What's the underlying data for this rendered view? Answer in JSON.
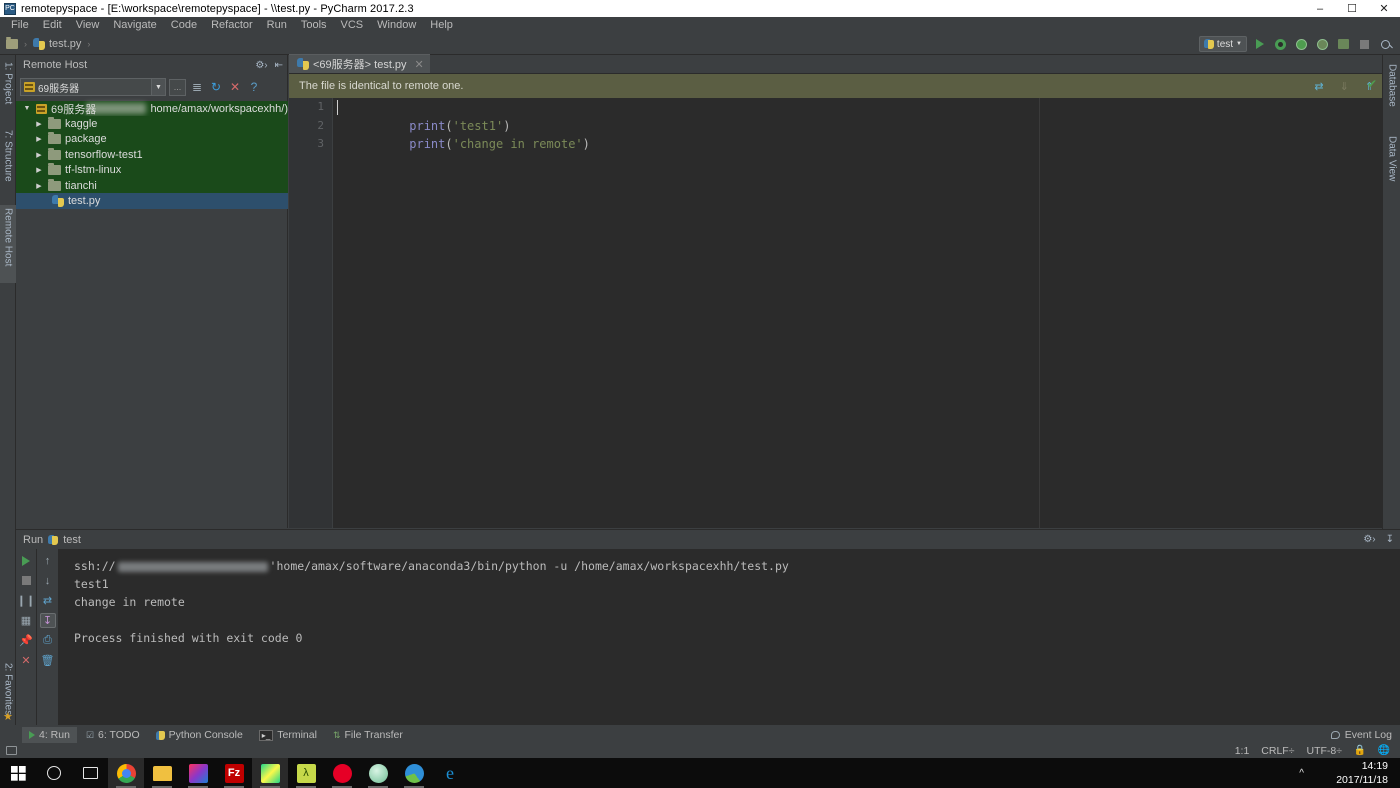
{
  "window": {
    "title": "remotepyspace - [E:\\workspace\\remotepyspace] - \\\\test.py - PyCharm 2017.2.3",
    "app_icon": "pycharm-icon",
    "minimize": "–",
    "maximize": "☐",
    "close": "✕"
  },
  "menu": {
    "items": [
      {
        "label": "File"
      },
      {
        "label": "Edit"
      },
      {
        "label": "View"
      },
      {
        "label": "Navigate"
      },
      {
        "label": "Code"
      },
      {
        "label": "Refactor"
      },
      {
        "label": "Run"
      },
      {
        "label": "Tools"
      },
      {
        "label": "VCS"
      },
      {
        "label": "Window"
      },
      {
        "label": "Help"
      }
    ]
  },
  "toolbar": {
    "breadcrumb_file": "test.py",
    "run_config": "test",
    "run_config_arrow": "▼",
    "icons": [
      "run-icon",
      "debug-icon",
      "coverage-icon",
      "profile-icon",
      "attach-icon",
      "stop-icon",
      "search-everywhere-icon"
    ]
  },
  "left_stripe": {
    "tabs": [
      {
        "label": "1: Project",
        "active": false
      },
      {
        "label": "7: Structure",
        "active": false
      },
      {
        "label": "Remote Host",
        "active": true
      }
    ],
    "bottom_tab": "2: Favorites"
  },
  "right_stripe": {
    "tabs": [
      {
        "label": "Database"
      },
      {
        "label": "Data View"
      }
    ]
  },
  "remote_host": {
    "title": "Remote Host",
    "server_select_value": "69服务器",
    "browse_label": "...",
    "toolbar_icons": [
      "settings-gear-icon",
      "collapse-all-icon",
      "browse-icon",
      "sync-icon",
      "refresh-icon",
      "close-icon",
      "help-icon"
    ],
    "tree": [
      {
        "label": "69服务器",
        "path_suffix": "home/amax/workspacexhh/)",
        "level": 0,
        "type": "server",
        "expanded": true,
        "redacted": true
      },
      {
        "label": "kaggle",
        "level": 1,
        "type": "folder",
        "expanded": false
      },
      {
        "label": "package",
        "level": 1,
        "type": "folder",
        "expanded": false
      },
      {
        "label": "tensorflow-test1",
        "level": 1,
        "type": "folder",
        "expanded": false
      },
      {
        "label": "tf-lstm-linux",
        "level": 1,
        "type": "folder",
        "expanded": false
      },
      {
        "label": "tianchi",
        "level": 1,
        "type": "folder",
        "expanded": false
      },
      {
        "label": "test.py",
        "level": 2,
        "type": "python-file",
        "selected": true
      }
    ]
  },
  "editor": {
    "tab_label": "<69服务器> test.py",
    "tab_close": "✕",
    "notification": "The file is identical to remote one.",
    "notification_icons": [
      "compare-diff-icon",
      "download-icon",
      "upload-icon"
    ],
    "inspection_status": "✔",
    "lines": [
      {
        "num": "1",
        "code_fn": "print",
        "code_open": "(",
        "code_str": "'test1'",
        "code_close": ")"
      },
      {
        "num": "2",
        "code_fn": "print",
        "code_open": "(",
        "code_str": "'change in remote'",
        "code_close": ")"
      },
      {
        "num": "3",
        "code_fn": "",
        "code_open": "",
        "code_str": "",
        "code_close": ""
      }
    ]
  },
  "run_window": {
    "title": "Run",
    "config_name": "test",
    "left_icons": [
      "rerun-icon",
      "stop-icon",
      "pause-icon",
      "print-console-icon",
      "pin-icon",
      "close-tab-icon"
    ],
    "right_icons": [
      "up-arrow-icon",
      "down-arrow-icon",
      "soft-wrap-icon",
      "scroll-to-end-icon",
      "print-icon",
      "trash-icon"
    ],
    "header_icons": [
      "settings-gear-icon",
      "hide-icon"
    ],
    "console": [
      {
        "text_pre": "ssh://",
        "redacted": true,
        "text_post": "'home/amax/software/anaconda3/bin/python -u /home/amax/workspacexhh/test.py"
      },
      {
        "text_pre": "test1",
        "redacted": false,
        "text_post": ""
      },
      {
        "text_pre": "change in remote",
        "redacted": false,
        "text_post": ""
      },
      {
        "text_pre": "",
        "redacted": false,
        "text_post": ""
      },
      {
        "text_pre": "Process finished with exit code 0",
        "redacted": false,
        "text_post": ""
      }
    ]
  },
  "bottom_tabs": {
    "items": [
      {
        "label": "4: Run",
        "icon": "run-icon",
        "active": true
      },
      {
        "label": "6: TODO",
        "icon": "todo-icon",
        "active": false
      },
      {
        "label": "Python Console",
        "icon": "python-icon",
        "active": false
      },
      {
        "label": "Terminal",
        "icon": "terminal-icon",
        "active": false
      },
      {
        "label": "File Transfer",
        "icon": "file-transfer-icon",
        "active": false
      }
    ],
    "event_log": "Event Log"
  },
  "status_bar": {
    "caret_position": "1:1",
    "line_separator": "CRLF÷",
    "encoding": "UTF-8÷",
    "lock_icon": "lock-icon",
    "globe_icon": "globe-icon"
  },
  "taskbar": {
    "start": "windows-start-icon",
    "cortana": "cortana-search-icon",
    "task_view": "task-view-icon",
    "apps": [
      {
        "name": "chrome-icon",
        "active": true,
        "color": "#4285f4"
      },
      {
        "name": "file-explorer-icon",
        "active": false,
        "color": "#ffc107"
      },
      {
        "name": "intellij-idea-icon",
        "active": false,
        "color": "#9c27b0"
      },
      {
        "name": "filezilla-icon",
        "active": false,
        "color": "#bf0000"
      },
      {
        "name": "pycharm-icon",
        "active": true,
        "color": "#21d789"
      },
      {
        "name": "matlab-icon",
        "active": false,
        "color": "#a3c34c"
      },
      {
        "name": "netease-music-icon",
        "active": false,
        "color": "#e60026"
      },
      {
        "name": "evernote-icon",
        "active": false,
        "color": "#7ecfa0"
      },
      {
        "name": "winrar-icon",
        "active": false,
        "color": "#4a9de0"
      },
      {
        "name": "edge-icon",
        "active": false,
        "color": "#1b8fd4"
      }
    ],
    "clock_time": "14:19",
    "clock_date": "2017/11/18"
  }
}
